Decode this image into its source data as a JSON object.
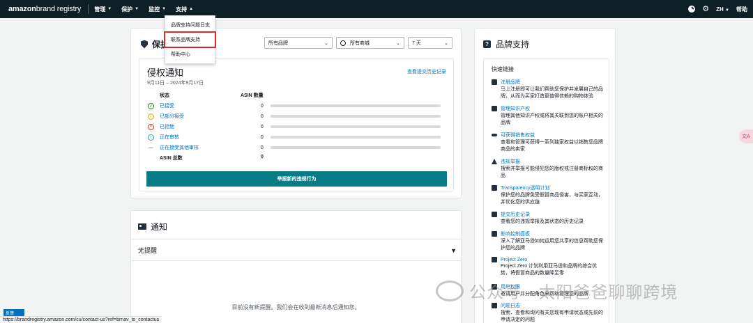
{
  "topbar": {
    "logo_bold": "amazon",
    "logo_light": "brand registry",
    "nav": [
      "管理",
      "保护",
      "监控",
      "支持"
    ],
    "right": {
      "lang": "ZH",
      "help": "帮助"
    }
  },
  "support_menu": {
    "items": [
      "品牌支持问题日志",
      "联系品牌支持",
      "帮助中心"
    ]
  },
  "protect_card": {
    "title": "保护",
    "brand_select": "所有品牌",
    "store_select": "所有商城",
    "days_select": "7 天",
    "notice": {
      "title": "侵权通知",
      "date_range": "9月11日 – 2024年9月17日",
      "history_link": "查看提交历史记录",
      "col_status": "状态",
      "col_count": "ASIN 数量",
      "rows": [
        {
          "label": "已接受",
          "count": "0"
        },
        {
          "label": "已部分接受",
          "count": "0"
        },
        {
          "label": "已拒绝",
          "count": "0"
        },
        {
          "label": "正在审核",
          "count": "0"
        },
        {
          "label": "正在接受其他审核",
          "count": "0"
        }
      ],
      "total_label": "ASIN 总数",
      "total_value": "0",
      "report_button": "举报新的违规行为"
    }
  },
  "notify_card": {
    "title": "通知",
    "filter": "无提醒",
    "empty": "目前没有新提醒。我们会在收到最新消息后通知您。"
  },
  "brand_support": {
    "title": "品牌支持",
    "quick_links": "快速链接",
    "links": [
      {
        "title": "注册品牌",
        "desc": "马上注册即可让我们帮助您保护并发展自己的品牌，从而为买家打造更值得信赖的购物体验"
      },
      {
        "title": "管理知识产权",
        "desc": "管理其他知识产权或将其关联到您的账户相关的品牌"
      },
      {
        "title": "可获得销售权益",
        "desc": "查看和管理可获得一系列独家权益以销售您品牌商品的卖家"
      },
      {
        "title": "违规举报",
        "desc": "搜索并举报可能侵犯您的版权或注册商标权的商品"
      },
      {
        "title": "Transparency透明计划",
        "desc": "保护您的品牌免受假冒商品侵害，与买家互动，并优化您的供应链"
      },
      {
        "title": "提交历史记录",
        "desc": "查看您的违规举报及其状态的历史记录"
      },
      {
        "title": "影响控制面板",
        "desc": "深入了解亚马逊如何运用您共享的信息帮助您保护您的品牌"
      },
      {
        "title": "Project Zero",
        "desc": "Project Zero 计划利用亚马逊和品牌的综合优势，将假冒商品的数量降至零"
      },
      {
        "title": "用户权限",
        "desc": "邀请用户并分配角色来帮助管理您的品牌"
      },
      {
        "title": "问题日志",
        "desc": "搜索、查看和询问有关您现有申请状态或先前的申请决定的问题"
      }
    ]
  },
  "statusbar": "https://brandregistry.amazon.com/cu/contact-us?ref=brnav_to_contactus",
  "feedback": "反馈",
  "watermark": "公众号 · 太阳爸爸聊聊跨境",
  "side_badge": "文A"
}
